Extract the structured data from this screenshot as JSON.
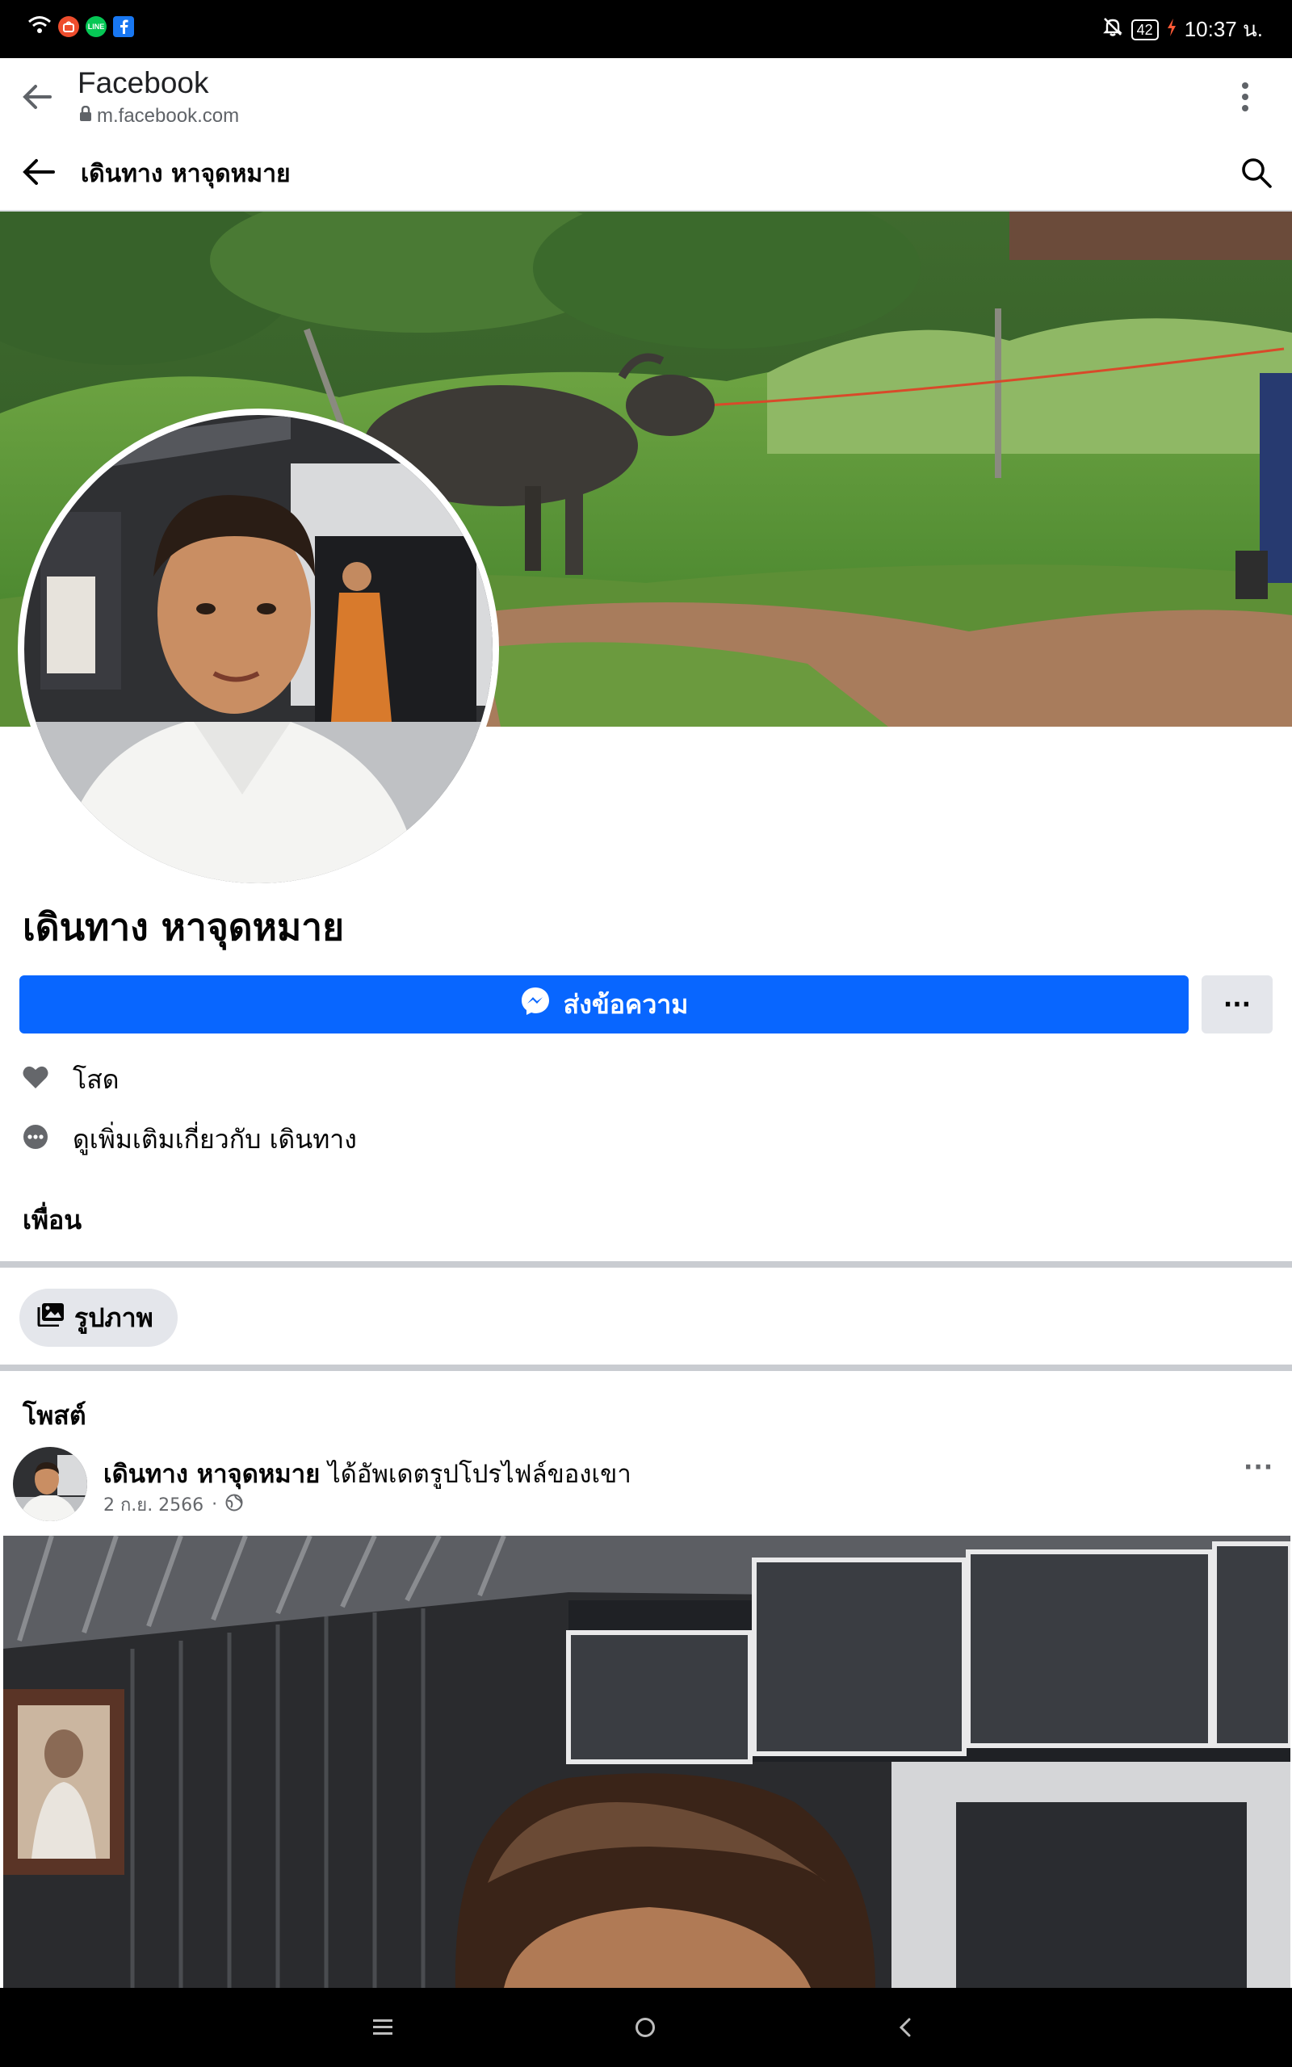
{
  "status_bar": {
    "apps": [
      "Shopee",
      "LINE",
      "Facebook"
    ],
    "app_labels": [
      "LINE"
    ],
    "battery": "42",
    "time": "10:37 น."
  },
  "browser": {
    "title": "Facebook",
    "url": "m.facebook.com"
  },
  "header": {
    "title": "เดินทาง หาจุดหมาย"
  },
  "profile": {
    "name": "เดินทาง หาจุดหมาย",
    "message_button": "ส่งข้อความ",
    "more_button": "···",
    "relationship": "โสด",
    "see_more_about": "ดูเพิ่มเติมเกี่ยวกับ เดินทาง",
    "friends_heading": "เพื่อน",
    "photos_chip": "รูปภาพ"
  },
  "posts": {
    "heading": "โพสต์",
    "items": [
      {
        "author": "เดินทาง หาจุดหมาย",
        "action": " ได้อัพเดตรูปโปรไฟล์ของเขา",
        "date": "2 ก.ย. 2566",
        "separator": "·",
        "more": "···"
      }
    ]
  },
  "nav_bar": {
    "icons": [
      "menu-icon",
      "home-icon",
      "back-icon"
    ]
  },
  "colors": {
    "accent": "#0866ff",
    "chip_bg": "#e4e6eb",
    "divider": "#c9ccd1",
    "secondary_text": "#65676b"
  }
}
